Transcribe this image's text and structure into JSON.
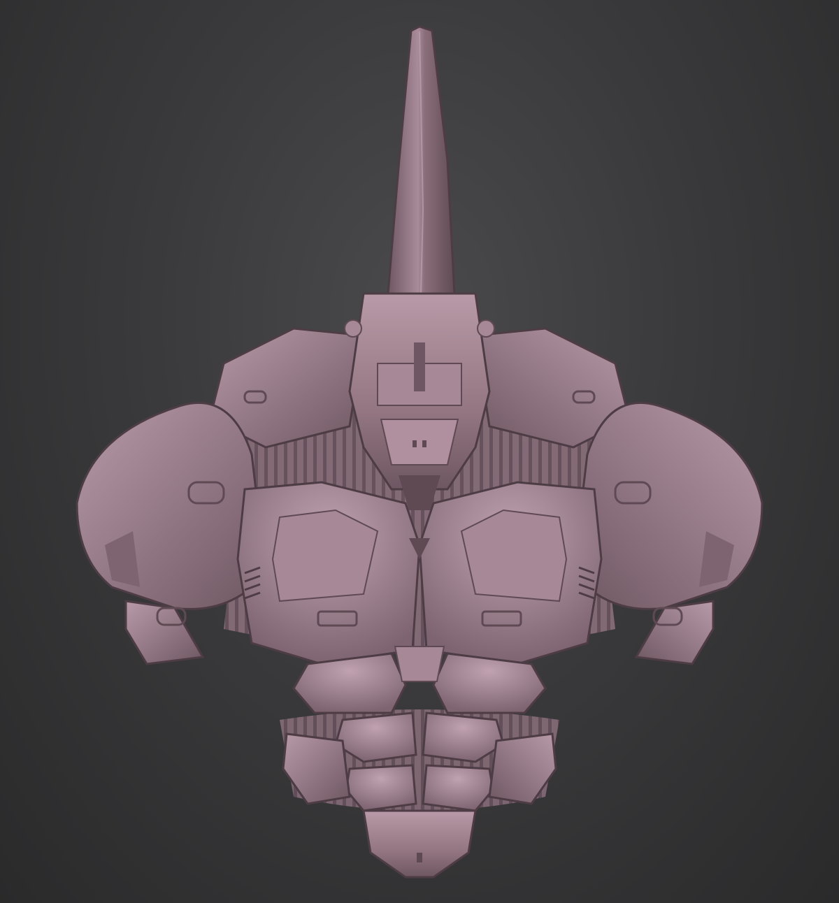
{
  "scene": {
    "subject_icon": "armored-rhino-bust-sculpt-icon",
    "colors": {
      "background_center": "#4a4a4c",
      "background_edge": "#2a2a2b",
      "clay_light": "#b89aa8",
      "clay_mid": "#937681",
      "clay_dark": "#5f4a54",
      "clay_shadow": "#3d2f36"
    }
  }
}
